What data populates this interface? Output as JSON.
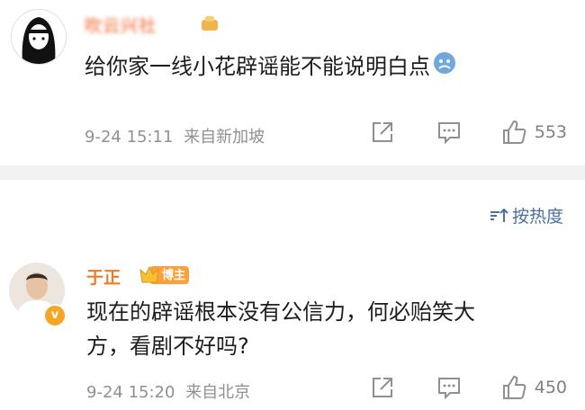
{
  "comments": [
    {
      "username": "吹云兴社",
      "text": "给你家一线小花辟谣能不能说明白点",
      "time": "9-24 15:11",
      "location": "来自新加坡",
      "likes": "553"
    },
    {
      "username": "于正",
      "badge_label": "博主",
      "verified_mark": "v",
      "text_line1": "现在的辟谣根本没有公信力，何必贻笑大",
      "text_line2": "方，看剧不好吗?",
      "time": "9-24 15:20",
      "location": "来自北京",
      "likes": "450"
    }
  ],
  "sort_label": "按热度",
  "icons": [
    "share-icon",
    "comment-icon",
    "like-icon",
    "sort-icon",
    "vip-crown-icon",
    "verified-icon",
    "emoji-icon"
  ],
  "colors": {
    "username_orange": "#ef7b27",
    "link_blue": "#4a6fa0",
    "meta_gray": "#909090"
  }
}
